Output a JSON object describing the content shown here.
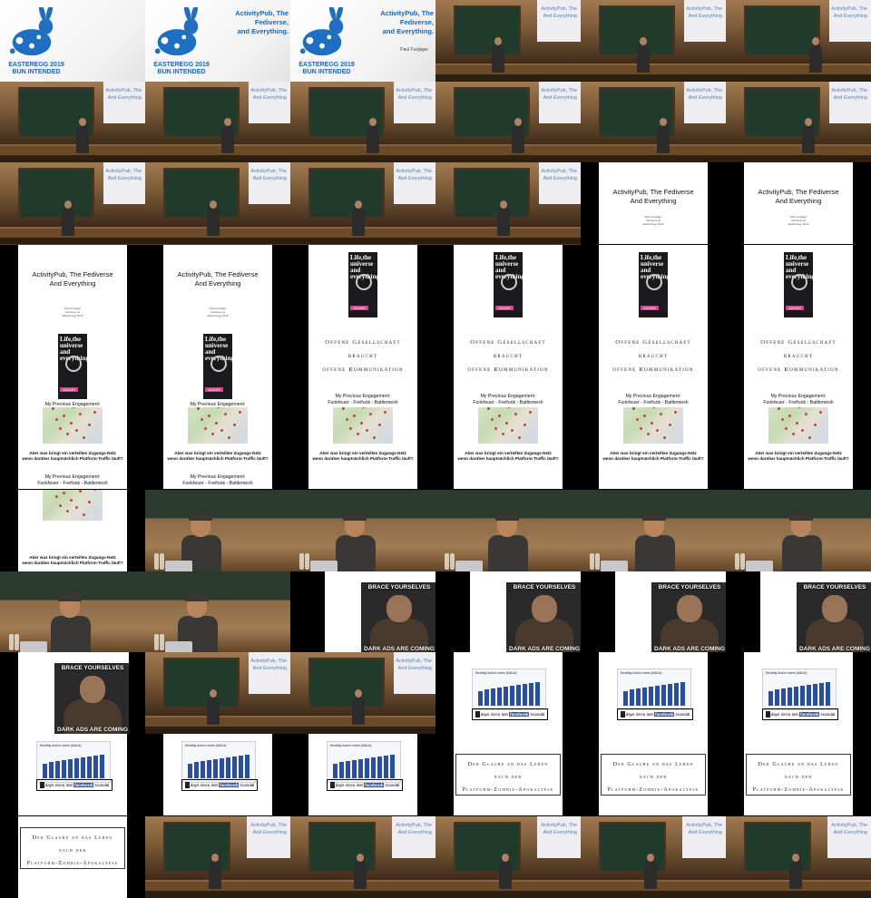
{
  "slides": {
    "event_logo": "EASTEREGG 2019\nBUN INTENDED",
    "title_short": "ActivityPub, The Fediverse,\nand Everything.",
    "author": "Paul Fuxjäger",
    "title_long": "ActivityPub, The Fediverse\nAnd Everything",
    "title_subline": "Paul Fuxjäger\nfunkfeuer.at\nEasterhegg 2019",
    "book_title": "Life,the universe and everything",
    "book_author": "ADAMS",
    "gesellschaft": [
      "Offene Gesellschaft",
      "braucht",
      "offene Kommunikation"
    ],
    "engagement": "My Previous Engagement:\nFunkfeuer - Freifunk - Battlemesh",
    "question": "Aber was bringt ein verteiltes Zugangs-Netz\nwenn darüber hauptsächlich Platform-Traffic läuft?",
    "meme_top": "BRACE YOURSELVES",
    "meme_bottom": "DARK ADS ARE COMING",
    "chart_title": "Monthly Active Users (MAUs)",
    "fb_days_pre": "days since last",
    "fb_brand": "facebook",
    "fb_days_post": "scandal",
    "glaube": [
      "Der Glaube an das Leben",
      "nach der",
      "Platform-Zombie-Apokalypse"
    ],
    "screen_text": "ActivityPub, The\nAnd Everything"
  },
  "tiles": [
    {
      "type": "title",
      "show_title": false
    },
    {
      "type": "title",
      "show_title": true,
      "show_author": false
    },
    {
      "type": "title",
      "show_title": true,
      "show_author": true
    },
    {
      "type": "room",
      "variant": 1
    },
    {
      "type": "room",
      "variant": 2
    },
    {
      "type": "room",
      "variant": 3
    },
    {
      "type": "room",
      "variant": 4
    },
    {
      "type": "room",
      "variant": 4
    },
    {
      "type": "room",
      "variant": 4
    },
    {
      "type": "room",
      "variant": 4
    },
    {
      "type": "room",
      "variant": 4
    },
    {
      "type": "room",
      "variant": 4
    },
    {
      "type": "room",
      "variant": 5
    },
    {
      "type": "room",
      "variant": 5
    },
    {
      "type": "room",
      "variant": 5
    },
    {
      "type": "room",
      "variant": 5
    },
    {
      "type": "slide",
      "block": "long-title-top"
    },
    {
      "type": "slide",
      "block": "long-title-top"
    },
    {
      "type": "slide",
      "block": "stack-a"
    },
    {
      "type": "slide",
      "block": "stack-a"
    },
    {
      "type": "slide",
      "block": "stack-b"
    },
    {
      "type": "slide",
      "block": "stack-b"
    },
    {
      "type": "slide",
      "block": "stack-b"
    },
    {
      "type": "slide",
      "block": "stack-b"
    },
    {
      "type": "slide",
      "block": "stack-a2"
    },
    {
      "type": "slide",
      "block": "stack-a2"
    },
    {
      "type": "slide",
      "block": "stack-b2"
    },
    {
      "type": "slide",
      "block": "stack-b2"
    },
    {
      "type": "slide",
      "block": "stack-b2"
    },
    {
      "type": "slide",
      "block": "stack-b2"
    },
    {
      "type": "slide",
      "block": "stack-a3"
    },
    {
      "type": "slide",
      "block": "stack-a3"
    },
    {
      "type": "slide",
      "block": "stack-b3"
    },
    {
      "type": "slide",
      "block": "stack-b3"
    },
    {
      "type": "slide",
      "block": "stack-b3"
    },
    {
      "type": "slide",
      "block": "stack-b3"
    },
    {
      "type": "slide",
      "block": "stack-a4"
    },
    {
      "type": "close",
      "pos": 40
    },
    {
      "type": "close",
      "pos": 50
    },
    {
      "type": "close",
      "pos": 58
    },
    {
      "type": "close",
      "pos": 60
    },
    {
      "type": "close",
      "pos": 62
    },
    {
      "type": "close",
      "pos": 56
    },
    {
      "type": "close",
      "pos": 36
    },
    {
      "type": "slide",
      "block": "meme-top"
    },
    {
      "type": "slide",
      "block": "meme-top"
    },
    {
      "type": "slide",
      "block": "meme-top"
    },
    {
      "type": "slide",
      "block": "meme-top"
    },
    {
      "type": "slide",
      "block": "meme-full"
    },
    {
      "type": "room",
      "variant": 5
    },
    {
      "type": "room",
      "variant": 5
    },
    {
      "type": "slide",
      "block": "chart-mid"
    },
    {
      "type": "slide",
      "block": "chart-mid"
    },
    {
      "type": "slide",
      "block": "chart-mid"
    },
    {
      "type": "slide",
      "block": "meme-rest"
    },
    {
      "type": "slide",
      "block": "chart-low"
    },
    {
      "type": "slide",
      "block": "chart-low"
    },
    {
      "type": "slide",
      "block": "glaube-top"
    },
    {
      "type": "slide",
      "block": "glaube-top"
    },
    {
      "type": "slide",
      "block": "glaube-top"
    },
    {
      "type": "slide",
      "block": "glaube-full"
    },
    {
      "type": "room",
      "variant": 6
    },
    {
      "type": "room",
      "variant": 6
    },
    {
      "type": "room",
      "variant": 6
    },
    {
      "type": "room",
      "variant": 6
    },
    {
      "type": "room",
      "variant": 6
    }
  ],
  "colors": {
    "accent": "#1565c0",
    "facebook": "#3b5998"
  }
}
